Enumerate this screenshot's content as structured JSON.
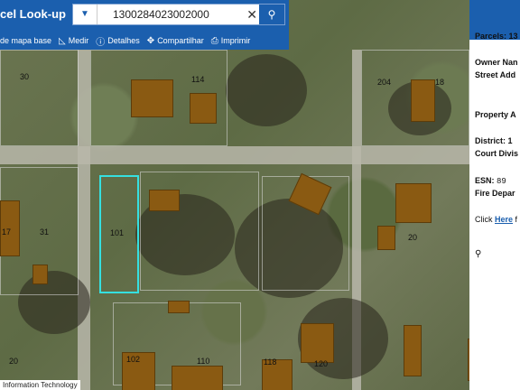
{
  "app": {
    "title": "cel Look-up"
  },
  "search": {
    "value": "1300284023002000",
    "dropdown_icon": "chevron-down-icon",
    "clear_icon": "close-icon",
    "search_icon": "search-icon"
  },
  "toolbar": {
    "items": [
      {
        "label": "de mapa base",
        "icon": "basemap-icon"
      },
      {
        "label": "Medir",
        "icon": "measure-icon"
      },
      {
        "label": "Detalhes",
        "icon": "info-icon"
      },
      {
        "label": "Compartilhar",
        "icon": "share-icon"
      },
      {
        "label": "Imprimir",
        "icon": "print-icon"
      }
    ]
  },
  "panel": {
    "parcels": "Parcels: 13",
    "owner": "Owner Nan",
    "street": "Street Add",
    "property": "Property A",
    "district": "District: 1",
    "court": "Court Divis",
    "esn_label": "ESN:",
    "esn_value": "89",
    "fire": "Fire Depar",
    "click_prefix": "Click ",
    "click_link": "Here",
    "click_suffix": " f",
    "zoom_icon": "zoom-icon"
  },
  "map": {
    "lot_numbers": [
      "30",
      "114",
      "204",
      "18",
      "31",
      "17",
      "101",
      "20",
      "102",
      "110",
      "118",
      "120",
      "21",
      "20"
    ],
    "attribution": "Information Technology"
  },
  "colors": {
    "brand": "#1b5fae",
    "selection": "#35e0e0",
    "building": "#8a5a12"
  }
}
